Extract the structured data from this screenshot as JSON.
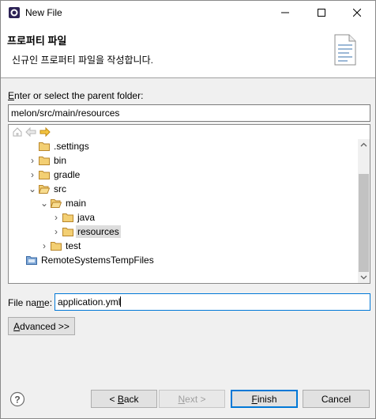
{
  "window": {
    "title": "New File",
    "icons": {
      "app": "eclipse-icon",
      "minimize": "minimize-icon",
      "maximize": "maximize-icon",
      "close": "close-icon"
    }
  },
  "header": {
    "title": "프로퍼티 파일",
    "description": "신규인 프로퍼티 파일을 작성합니다.",
    "icon": "properties-file-icon"
  },
  "parent_folder": {
    "label_mnemonic": "E",
    "label_rest": "nter or select the parent folder:",
    "value": "melon/src/main/resources"
  },
  "tree": {
    "toolbar_icons": [
      "home-icon",
      "back-icon",
      "forward-icon"
    ],
    "items": [
      {
        "label": ".settings",
        "expander": "",
        "icon": "folder-icon"
      },
      {
        "label": "bin",
        "expander": "›",
        "icon": "folder-icon"
      },
      {
        "label": "gradle",
        "expander": "›",
        "icon": "folder-icon"
      },
      {
        "label": "src",
        "expander": "⌄",
        "icon": "folder-open-icon"
      },
      {
        "label": "main",
        "expander": "⌄",
        "icon": "folder-open-icon"
      },
      {
        "label": "java",
        "expander": "›",
        "icon": "folder-icon"
      },
      {
        "label": "resources",
        "expander": "›",
        "icon": "folder-icon",
        "selected": true
      },
      {
        "label": "test",
        "expander": "›",
        "icon": "folder-icon"
      },
      {
        "label": "RemoteSystemsTempFiles",
        "expander": "",
        "icon": "project-icon"
      }
    ]
  },
  "file_name": {
    "label_pre": "File na",
    "label_mnemonic": "m",
    "label_post": "e:",
    "value": "application.yml"
  },
  "advanced_button": {
    "mnemonic": "A",
    "rest": "dvanced >>"
  },
  "footer": {
    "help_icon": "help-icon",
    "back": {
      "pre": "< ",
      "mnemonic": "B",
      "rest": "ack"
    },
    "next": {
      "mnemonic": "N",
      "rest": "ext >"
    },
    "finish": {
      "mnemonic": "F",
      "rest": "inish"
    },
    "cancel": "Cancel"
  },
  "colors": {
    "accent": "#0078d7",
    "folder": "#e8b64a",
    "selection": "#dddddd"
  }
}
